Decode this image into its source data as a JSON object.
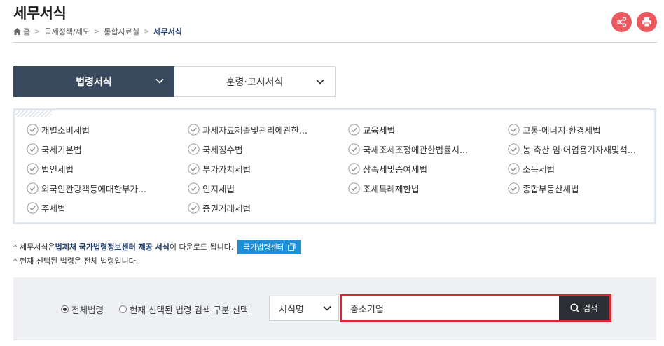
{
  "header": {
    "title": "세무서식",
    "breadcrumb": [
      "홈",
      "국세정책/제도",
      "통합자료실",
      "세무서식"
    ]
  },
  "actions": {
    "share_icon": "share-icon",
    "print_icon": "print-icon",
    "color": "#eb5a61"
  },
  "tabs": [
    {
      "label": "법령서식",
      "active": true
    },
    {
      "label": "훈령·고시서식",
      "active": false
    }
  ],
  "laws": [
    "개별소비세법",
    "과세자료제출및관리에관한...",
    "교육세법",
    "교통·에너지·환경세법",
    "국세기본법",
    "국세징수법",
    "국제조세조정에관한법률시...",
    "농·축산·임·어업용기자재및석...",
    "법인세법",
    "부가가치세법",
    "상속세및증여세법",
    "소득세법",
    "외국인관광객등에대한부가...",
    "인지세법",
    "조세특례제한법",
    "종합부동산세법",
    "주세법",
    "증권거래세법"
  ],
  "notes": {
    "line1_prefix": "* 세무서식은 ",
    "line1_highlight": "법제처 국가법령정보센터 제공 서식",
    "line1_suffix": "이 다운로드 됩니다.",
    "button_label": "국가법령센터",
    "line2": "* 현재 선택된 법령은 전체 법령입니다."
  },
  "search": {
    "radio_all": "전체법령",
    "radio_selected": "현재 선택된 법령 검색 구분 선택",
    "radio_all_checked": true,
    "select_value": "서식명",
    "input_value": "중소기업",
    "button_label": "검색"
  },
  "colors": {
    "tab_active": "#3a4a5e",
    "link_button": "#1f8fd6",
    "search_highlight": "#e0252f",
    "search_button": "#2b2f33"
  }
}
